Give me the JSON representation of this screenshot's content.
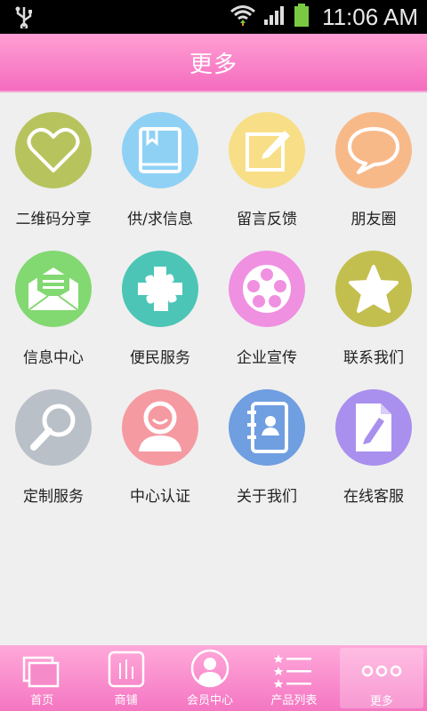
{
  "status_bar": {
    "time": "11:06 AM"
  },
  "header": {
    "title": "更多"
  },
  "grid": [
    {
      "label": "二维码分享",
      "icon": "heart-icon",
      "color": "#b7c45e"
    },
    {
      "label": "供/求信息",
      "icon": "book-icon",
      "color": "#8fd1f5"
    },
    {
      "label": "留言反馈",
      "icon": "edit-icon",
      "color": "#f8df87"
    },
    {
      "label": "朋友圈",
      "icon": "speech-bubble-icon",
      "color": "#f8b989"
    },
    {
      "label": "信息中心",
      "icon": "mail-icon",
      "color": "#82d871"
    },
    {
      "label": "便民服务",
      "icon": "puzzle-icon",
      "color": "#4cc5b6"
    },
    {
      "label": "企业宣传",
      "icon": "film-reel-icon",
      "color": "#ef90e1"
    },
    {
      "label": "联系我们",
      "icon": "star-icon",
      "color": "#c3bf4e"
    },
    {
      "label": "定制服务",
      "icon": "magnifier-icon",
      "color": "#b9c0c8"
    },
    {
      "label": "中心认证",
      "icon": "user-icon",
      "color": "#f59aa1"
    },
    {
      "label": "关于我们",
      "icon": "contacts-icon",
      "color": "#6f9ee1"
    },
    {
      "label": "在线客服",
      "icon": "document-edit-icon",
      "color": "#a98fee"
    }
  ],
  "tabbar": [
    {
      "label": "首页",
      "icon": "windows-icon"
    },
    {
      "label": "商铺",
      "icon": "shop-icon"
    },
    {
      "label": "会员中心",
      "icon": "member-icon"
    },
    {
      "label": "产品列表",
      "icon": "list-icon"
    },
    {
      "label": "更多",
      "icon": "more-dots-icon",
      "active": true
    }
  ]
}
